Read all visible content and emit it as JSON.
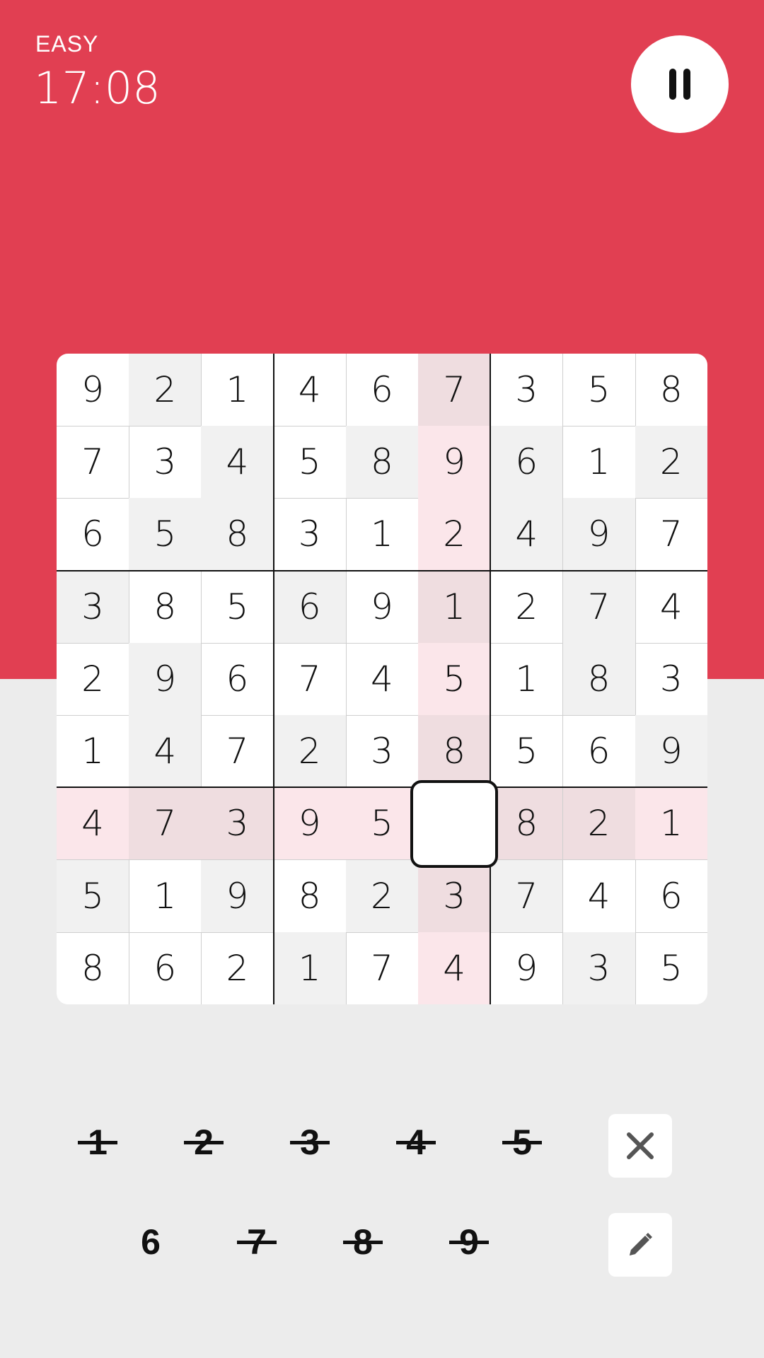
{
  "header": {
    "difficulty": "EASY",
    "timer": "17:08"
  },
  "colors": {
    "accent": "#e13f52",
    "background": "#ececec",
    "highlight_grey": "#f1f1f1",
    "highlight_pink": "#fbe6ea",
    "highlight_rose": "#efdde0"
  },
  "board": {
    "rows": [
      [
        "9",
        "2",
        "1",
        "4",
        "6",
        "7",
        "3",
        "5",
        "8"
      ],
      [
        "7",
        "3",
        "4",
        "5",
        "8",
        "9",
        "6",
        "1",
        "2"
      ],
      [
        "6",
        "5",
        "8",
        "3",
        "1",
        "2",
        "4",
        "9",
        "7"
      ],
      [
        "3",
        "8",
        "5",
        "6",
        "9",
        "1",
        "2",
        "7",
        "4"
      ],
      [
        "2",
        "9",
        "6",
        "7",
        "4",
        "5",
        "1",
        "8",
        "3"
      ],
      [
        "1",
        "4",
        "7",
        "2",
        "3",
        "8",
        "5",
        "6",
        "9"
      ],
      [
        "4",
        "7",
        "3",
        "9",
        "5",
        "",
        "8",
        "2",
        "1"
      ],
      [
        "5",
        "1",
        "9",
        "8",
        "2",
        "3",
        "7",
        "4",
        "6"
      ],
      [
        "8",
        "6",
        "2",
        "1",
        "7",
        "4",
        "9",
        "3",
        "5"
      ]
    ],
    "shading": [
      [
        "",
        "grey",
        "",
        "",
        "",
        "rose",
        "",
        "",
        ""
      ],
      [
        "",
        "",
        "grey",
        "",
        "grey",
        "pink",
        "grey",
        "",
        "grey"
      ],
      [
        "",
        "grey",
        "grey",
        "",
        "",
        "pink",
        "grey",
        "grey",
        ""
      ],
      [
        "grey",
        "",
        "",
        "grey",
        "",
        "rose",
        "",
        "grey",
        ""
      ],
      [
        "",
        "grey",
        "",
        "",
        "",
        "pink",
        "",
        "grey",
        ""
      ],
      [
        "",
        "grey",
        "",
        "grey",
        "",
        "rose",
        "",
        "",
        "grey"
      ],
      [
        "pink",
        "rose",
        "rose",
        "pink",
        "pink",
        "",
        "rose",
        "rose",
        "pink"
      ],
      [
        "grey",
        "",
        "grey",
        "",
        "grey",
        "rose",
        "grey",
        "",
        ""
      ],
      [
        "",
        "",
        "",
        "grey",
        "",
        "pink",
        "",
        "grey",
        ""
      ]
    ],
    "selected": {
      "row": 6,
      "col": 5
    }
  },
  "keypad": {
    "numbers": [
      {
        "label": "1",
        "used": true
      },
      {
        "label": "2",
        "used": true
      },
      {
        "label": "3",
        "used": true
      },
      {
        "label": "4",
        "used": true
      },
      {
        "label": "5",
        "used": true
      },
      {
        "label": "6",
        "used": false
      },
      {
        "label": "7",
        "used": true
      },
      {
        "label": "8",
        "used": true
      },
      {
        "label": "9",
        "used": true
      }
    ],
    "erase_icon": "close-icon",
    "notes_icon": "pencil-icon"
  }
}
